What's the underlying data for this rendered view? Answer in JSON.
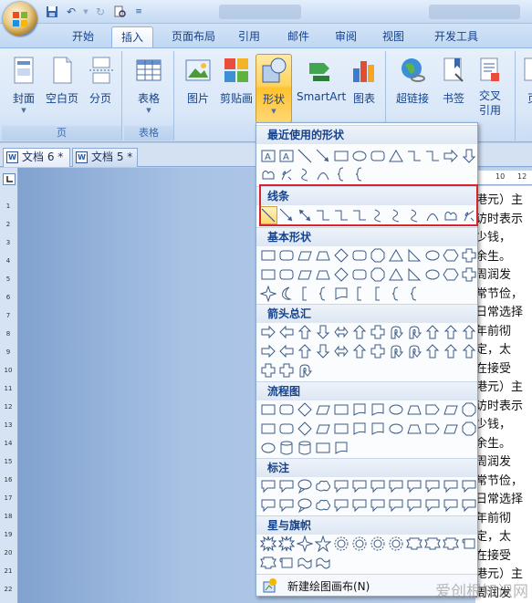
{
  "ribbon_tabs": [
    "开始",
    "插入",
    "页面布局",
    "引用",
    "邮件",
    "审阅",
    "视图",
    "开发工具"
  ],
  "active_tab": "插入",
  "groups": {
    "pages": {
      "label": "页",
      "buttons": [
        "封面",
        "空白页",
        "分页"
      ]
    },
    "table": {
      "label": "表格",
      "buttons": [
        "表格"
      ]
    },
    "illustrations": {
      "buttons": [
        "图片",
        "剪贴画",
        "形状",
        "SmartArt",
        "图表"
      ]
    },
    "links": {
      "buttons": [
        "超链接",
        "书签",
        "交叉引用"
      ]
    },
    "next": {
      "buttons": [
        "页"
      ]
    }
  },
  "doc_tabs": [
    "文档 6 *",
    "文档 5 *"
  ],
  "ruler": {
    "horizontal": [
      "10",
      "12"
    ],
    "vertical": [
      "1",
      "2",
      "3",
      "4",
      "5",
      "6",
      "7",
      "8",
      "9",
      "10",
      "11",
      "12",
      "13",
      "14",
      "15",
      "16",
      "17",
      "18",
      "19",
      "20",
      "21",
      "22"
    ]
  },
  "document_lines": [
    "港元）主",
    "访时表示",
    "少钱，",
    "余生。",
    "周润发",
    "常节俭，",
    "日常选择",
    "年前彻",
    "定，太",
    "在接受",
    "港元）主",
    "访时表示",
    "少钱，",
    "余生。",
    "周润发",
    "常节俭，",
    "日常选择",
    "年前彻",
    "定，太",
    "在接受",
    "港元）主",
    "周润发"
  ],
  "shapes_menu": {
    "sections": [
      "最近使用的形状",
      "线条",
      "基本形状",
      "箭头总汇",
      "流程图",
      "标注",
      "星与旗帜"
    ],
    "new_canvas": "新建绘图画布(N)"
  },
  "colors": {
    "highlight_border": "#d8242f",
    "selected_shape": "#ffd76e",
    "ribbon_text": "#15428b"
  },
  "watermark": "爱创根知识网"
}
